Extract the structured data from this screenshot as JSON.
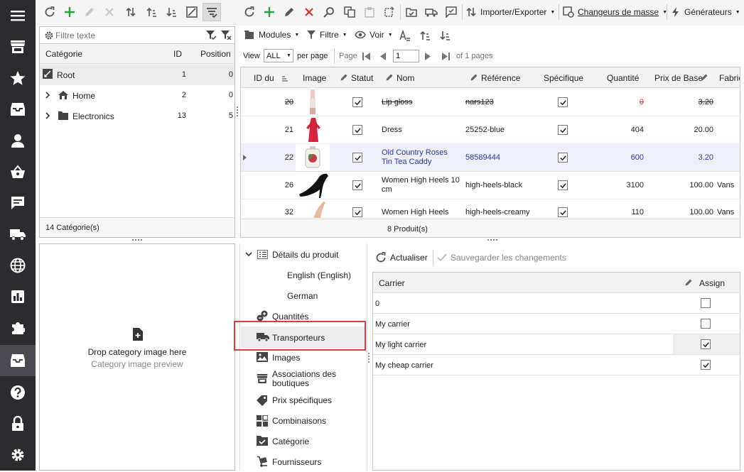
{
  "toolbar": {
    "importer_label": "Importer/Exporter",
    "changeurs_label": "Changeurs de masse",
    "generateurs_label": "Générateurs",
    "modules_label": "Modules",
    "filtre_label": "Filtre",
    "voir_label": "Voir"
  },
  "cat_panel": {
    "filter_placeholder": "Filtre texte",
    "col_categorie": "Catégorie",
    "col_id": "ID",
    "col_position": "Position",
    "rows": [
      {
        "name": "Root",
        "id": "1",
        "position": "0"
      },
      {
        "name": "Home",
        "id": "2",
        "position": "0"
      },
      {
        "name": "Electronics",
        "id": "13",
        "position": "5"
      }
    ],
    "footer": "14 Catégorie(s)"
  },
  "pager": {
    "view_label": "View",
    "view_value": "ALL",
    "per_page": "per page",
    "page_label": "Page",
    "page_value": "1",
    "of_pages": "of 1 pages"
  },
  "products": {
    "columns": {
      "id": "ID du",
      "image": "Image",
      "statut": "Statut",
      "nom": "Nom",
      "reference": "Référence",
      "specifique": "Spécifique",
      "quantite": "Quantité",
      "prix": "Prix de Base",
      "fabric": "Fabric"
    },
    "rows": [
      {
        "id": "20",
        "nom": "Lip gloss",
        "reference": "nars123",
        "quantite": "0",
        "prix": "3.20",
        "fabric": ""
      },
      {
        "id": "21",
        "nom": "Dress",
        "reference": "25252-blue",
        "quantite": "404",
        "prix": "20.00",
        "fabric": ""
      },
      {
        "id": "22",
        "nom": "Old Country Roses Tin Tea Caddy",
        "reference": "58589444",
        "quantite": "600",
        "prix": "3.20",
        "fabric": ""
      },
      {
        "id": "26",
        "nom": "Women High Heels 10 cm",
        "reference": "high-heels-black",
        "quantite": "3100",
        "prix": "100.00",
        "fabric": "Vans"
      },
      {
        "id": "32",
        "nom": "Women High Heels",
        "reference": "high-heels-creamy",
        "quantite": "110",
        "prix": "100.00",
        "fabric": "Vans"
      }
    ],
    "footer": "8 Produit(s)"
  },
  "image_panel": {
    "drop_label": "Drop category image here",
    "preview_label": "Category image preview"
  },
  "details": {
    "items": [
      {
        "label": "Détails du produit"
      },
      {
        "label": "English (English)"
      },
      {
        "label": "German"
      },
      {
        "label": "Quantités"
      },
      {
        "label": "Transporteurs"
      },
      {
        "label": "Images"
      },
      {
        "label": "Associations des boutiques"
      },
      {
        "label": "Prix spécifiques"
      },
      {
        "label": "Combinaisons"
      },
      {
        "label": "Catégorie"
      },
      {
        "label": "Fournisseurs"
      }
    ]
  },
  "carrier_panel": {
    "refresh_label": "Actualiser",
    "save_label": "Sauvegarder les changements",
    "col_carrier": "Carrier",
    "col_assign": "Assign",
    "rows": [
      {
        "name": "0",
        "assigned": false
      },
      {
        "name": "My carrier",
        "assigned": false
      },
      {
        "name": "My light carrier",
        "assigned": true
      },
      {
        "name": "My cheap carrier",
        "assigned": true
      }
    ]
  },
  "colors": {
    "sidebar_bg": "#2c2c30",
    "accent_green": "#2ea043",
    "accent_red": "#d32f2f",
    "selected_text": "#2a3d9a",
    "highlight_border": "#e0393e"
  }
}
